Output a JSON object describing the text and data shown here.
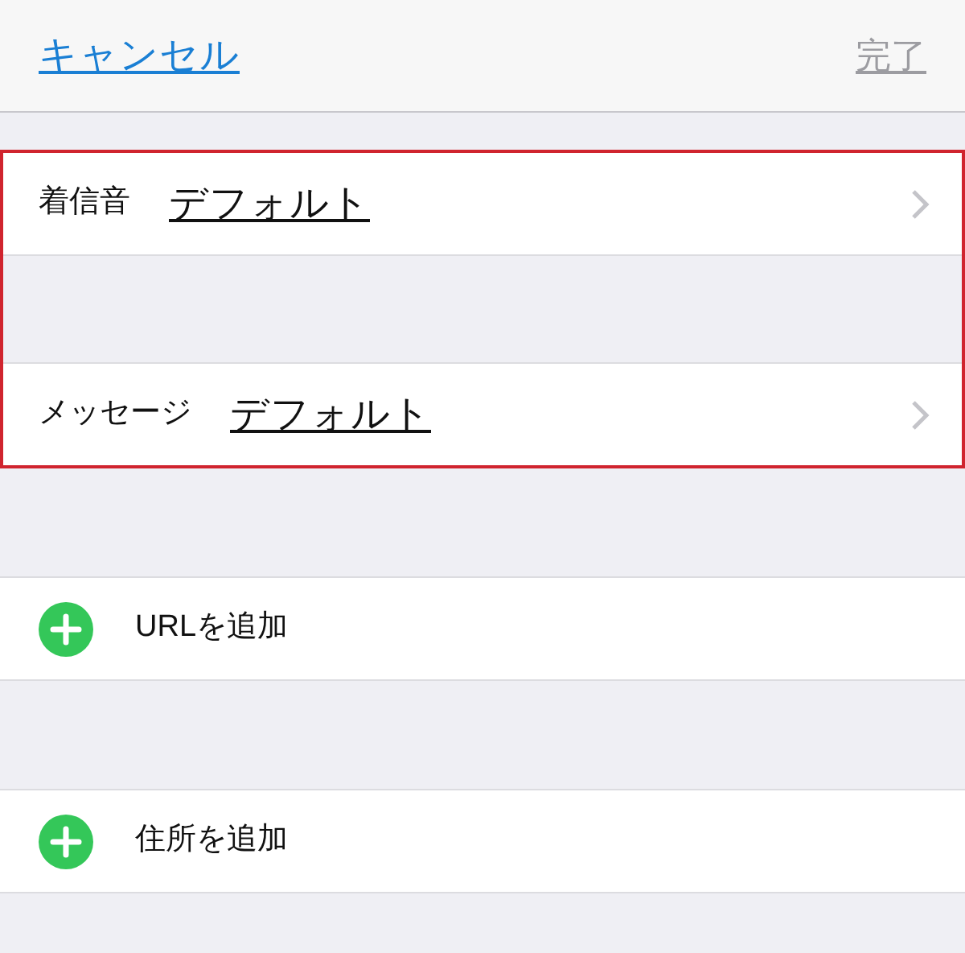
{
  "nav": {
    "cancel": "キャンセル",
    "done": {
      "label": "完了",
      "disabled": true
    }
  },
  "sound_settings": {
    "highlighted": true,
    "rows": [
      {
        "label": "着信音",
        "value": "デフォルト"
      },
      {
        "label": "メッセージ",
        "value": "デフォルト"
      }
    ]
  },
  "add_rows": [
    {
      "label": "URLを追加"
    },
    {
      "label": "住所を追加"
    }
  ]
}
